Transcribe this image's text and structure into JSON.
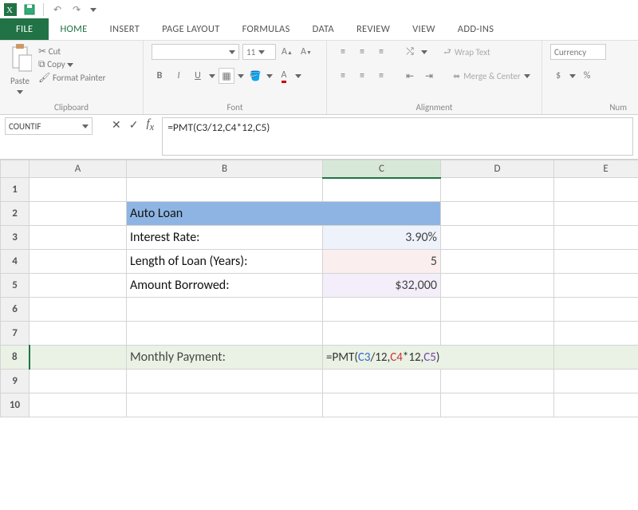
{
  "qat": {
    "label": "Quick Access Toolbar"
  },
  "tabs": {
    "file": "FILE",
    "home": "HOME",
    "insert": "INSERT",
    "page_layout": "PAGE LAYOUT",
    "formulas": "FORMULAS",
    "data": "DATA",
    "review": "REVIEW",
    "view": "VIEW",
    "addins": "ADD-INS"
  },
  "ribbon": {
    "clipboard": {
      "paste": "Paste",
      "cut": "Cut",
      "copy": "Copy",
      "fmt_painter": "Format Painter",
      "label": "Clipboard"
    },
    "font": {
      "name": "",
      "size": "11",
      "label": "Font"
    },
    "alignment": {
      "wrap": "Wrap Text",
      "merge": "Merge & Center",
      "label": "Alignment"
    },
    "number": {
      "format": "Currency",
      "label": "Num"
    }
  },
  "name_box": "COUNTIF",
  "formula_bar": "=PMT(C3/12,C4*12,C5)",
  "columns": [
    "A",
    "B",
    "C",
    "D",
    "E"
  ],
  "rows": [
    "1",
    "2",
    "3",
    "4",
    "5",
    "6",
    "7",
    "8",
    "9",
    "10"
  ],
  "cells": {
    "B2": "Auto Loan",
    "B3": "Interest Rate:",
    "C3": "3.90%",
    "B4": "Length of Loan (Years):",
    "C4": "5",
    "B5": "Amount Borrowed:",
    "C5": "$32,000",
    "B8": "Monthly Payment:",
    "C8_prefix": "=PMT(",
    "C8_ref1": "C3",
    "C8_t1": "/12,",
    "C8_ref2": "C4",
    "C8_t2": "*12,",
    "C8_ref3": "C5",
    "C8_suffix": ")"
  },
  "active_cell": "C8"
}
